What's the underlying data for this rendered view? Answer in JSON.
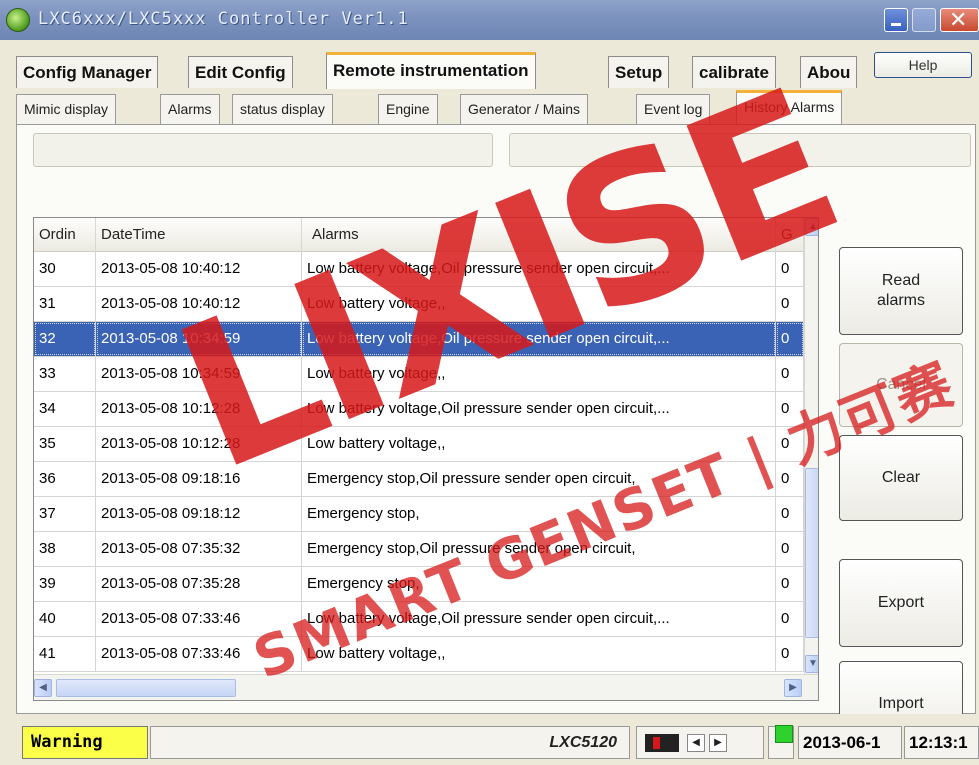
{
  "window": {
    "title": "LXC6xxx/LXC5xxx Controller Ver1.1"
  },
  "top_tabs": [
    {
      "label": "Config Manager"
    },
    {
      "label": "Edit Config"
    },
    {
      "label": "Remote instrumentation",
      "active": true
    },
    {
      "label": "Setup"
    },
    {
      "label": "calibrate"
    },
    {
      "label": "Abou"
    }
  ],
  "help_label": "Help",
  "sub_tabs": [
    {
      "label": "Mimic display"
    },
    {
      "label": "Alarms"
    },
    {
      "label": "status display"
    },
    {
      "label": "Engine"
    },
    {
      "label": "Generator / Mains"
    },
    {
      "label": "Event log"
    },
    {
      "label": "History Alarms",
      "active": true
    }
  ],
  "fields": [
    {
      "value": ""
    },
    {
      "value": ""
    }
  ],
  "grid": {
    "columns": [
      "Ordin",
      "DateTime",
      "Alarms",
      "G"
    ],
    "selected_row": 2,
    "rows": [
      {
        "ordin": "30",
        "datetime": "2013-05-08 10:40:12",
        "alarms": "Low battery voltage,Oil pressure sender open circuit,...",
        "g": "0"
      },
      {
        "ordin": "31",
        "datetime": "2013-05-08 10:40:12",
        "alarms": "Low battery voltage,,",
        "g": "0"
      },
      {
        "ordin": "32",
        "datetime": "2013-05-08 10:34:59",
        "alarms": "Low battery voltage,Oil pressure sender open circuit,...",
        "g": "0"
      },
      {
        "ordin": "33",
        "datetime": "2013-05-08 10:34:59",
        "alarms": "Low battery voltage,,",
        "g": "0"
      },
      {
        "ordin": "34",
        "datetime": "2013-05-08 10:12:28",
        "alarms": "Low battery voltage,Oil pressure sender open circuit,...",
        "g": "0"
      },
      {
        "ordin": "35",
        "datetime": "2013-05-08 10:12:28",
        "alarms": "Low battery voltage,,",
        "g": "0"
      },
      {
        "ordin": "36",
        "datetime": "2013-05-08 09:18:16",
        "alarms": "Emergency stop,Oil pressure sender open circuit,",
        "g": "0"
      },
      {
        "ordin": "37",
        "datetime": "2013-05-08 09:18:12",
        "alarms": "Emergency stop,",
        "g": "0"
      },
      {
        "ordin": "38",
        "datetime": "2013-05-08 07:35:32",
        "alarms": "Emergency stop,Oil pressure sender open circuit,",
        "g": "0"
      },
      {
        "ordin": "39",
        "datetime": "2013-05-08 07:35:28",
        "alarms": "Emergency stop,",
        "g": "0"
      },
      {
        "ordin": "40",
        "datetime": "2013-05-08 07:33:46",
        "alarms": "Low battery voltage,Oil pressure sender open circuit,...",
        "g": "0"
      },
      {
        "ordin": "41",
        "datetime": "2013-05-08 07:33:46",
        "alarms": "Low battery voltage,,",
        "g": "0"
      }
    ]
  },
  "buttons": {
    "read_alarms": "Read\nalarms",
    "cancel": "Cancel",
    "clear": "Clear",
    "export": "Export",
    "import": "Import"
  },
  "statusbar": {
    "warning": "Warning",
    "model": "LXC5120",
    "date": "2013-06-1",
    "time": "12:13:1"
  },
  "watermark": {
    "big": "LIXISE",
    "small": "SMART GENSET | 力可赛"
  },
  "colors": {
    "selection": "#3a62b5",
    "tab_accent": "#f2b23a",
    "warning_bg": "#fbff47",
    "status_led": "#2fd12f",
    "watermark": "#d81919"
  }
}
